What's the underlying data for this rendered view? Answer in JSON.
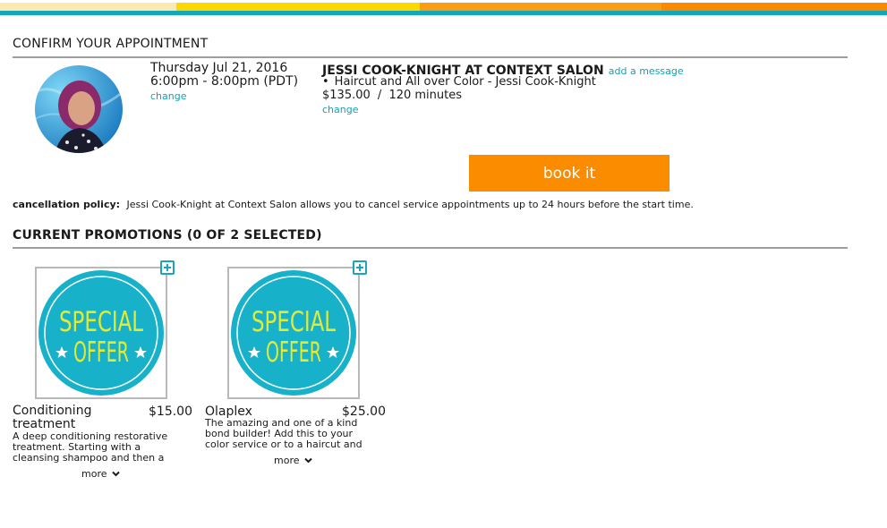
{
  "colors": {
    "stripe_cream": "#fbe8b2",
    "stripe_yellow": "#fcd700",
    "stripe_orange": "#fb9c14",
    "stripe_dark_orange": "#fb8a00",
    "teal": "#14a7b8",
    "accent_button": "#fb8c00",
    "badge_circle": "#17b1c9",
    "badge_text": "#e3ea34"
  },
  "confirm": {
    "heading": "CONFIRM YOUR APPOINTMENT",
    "date": "Thursday Jul 21, 2016",
    "time": "6:00pm - 8:00pm (PDT)",
    "date_change_link": "change",
    "provider": "JESSI COOK-KNIGHT AT CONTEXT SALON",
    "add_message_link": "add a message",
    "service": "Haircut and All over Color - Jessi Cook-Knight",
    "price": "$135.00",
    "duration_separator": "/",
    "duration": "120 minutes",
    "service_change_link": "change",
    "book_button": "book it"
  },
  "policy": {
    "label": "cancellation policy:",
    "text": "Jessi Cook-Knight at Context Salon allows you to cancel service appointments up to 24 hours before the start time."
  },
  "promotions": {
    "heading": "CURRENT PROMOTIONS (0 OF 2 SELECTED)",
    "items": [
      {
        "badge_line1": "SPECIAL",
        "badge_line2": "OFFER",
        "name_line1": "Conditioning",
        "name_line2": "treatment",
        "price": "$15.00",
        "desc_line1": "A deep conditioning restorative",
        "desc_line2": "treatment. Starting with a",
        "desc_line3": "cleansing shampoo and then a",
        "more": "more"
      },
      {
        "badge_line1": "SPECIAL",
        "badge_line2": "OFFER",
        "name_line1": "Olaplex",
        "price": "$25.00",
        "desc_line1": "The amazing and one of a kind",
        "desc_line2": "bond builder! Add this to your",
        "desc_line3": "color service or to a haircut and",
        "more": "more"
      }
    ]
  },
  "icons": {
    "add_promo": "plus-square-icon",
    "expand": "chevron-down-icon",
    "bullet": "bullet-icon"
  }
}
